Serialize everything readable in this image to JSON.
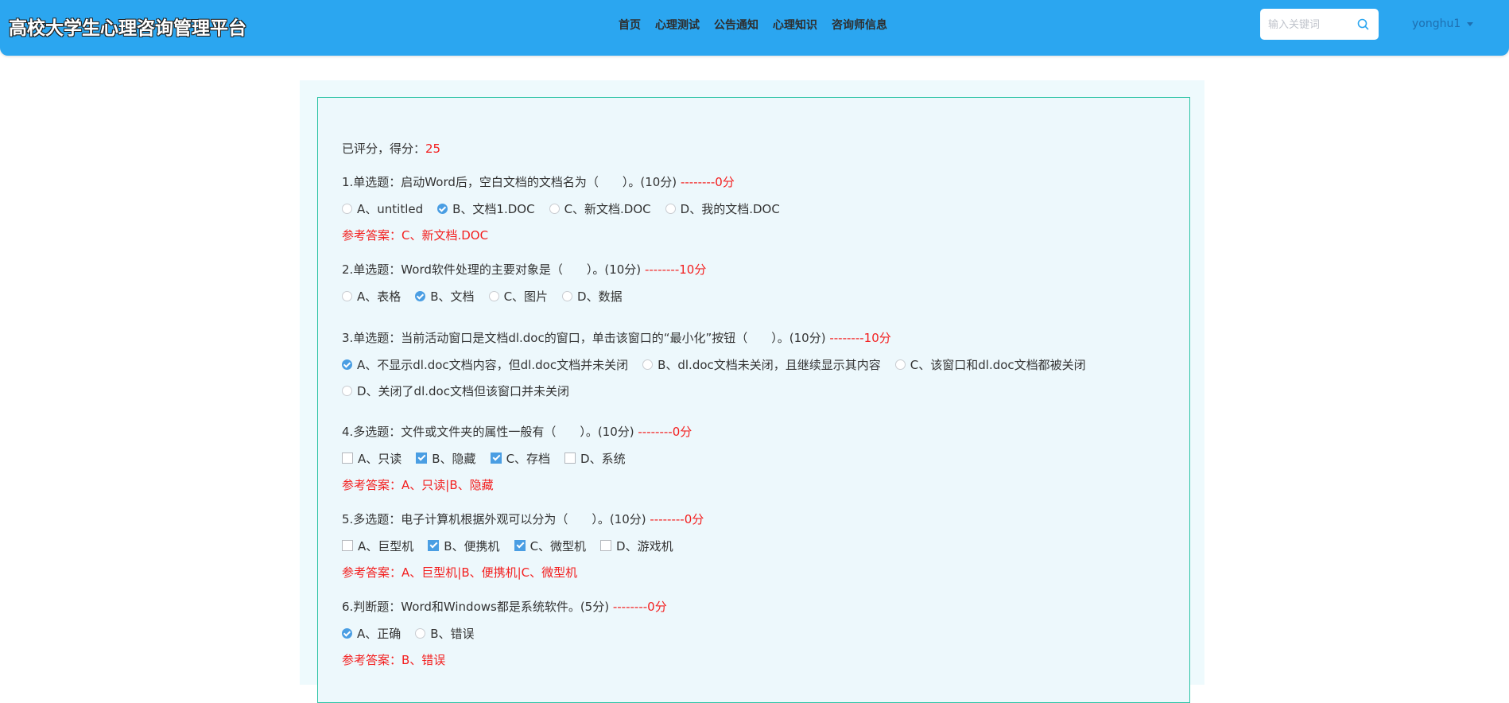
{
  "header": {
    "title": "高校大学生心理咨询管理平台",
    "nav": [
      "首页",
      "心理测试",
      "公告通知",
      "心理知识",
      "咨询师信息"
    ],
    "search_placeholder": "输入关键词",
    "user": "yonghu1"
  },
  "result": {
    "label": "已评分，得分：",
    "score": "25"
  },
  "questions": [
    {
      "title": "1.单选题：启动Word后，空白文档的文档名为（　　）。(10分)",
      "points": "--------0分",
      "options": [
        "A、untitled",
        "B、文档1.DOC",
        "C、新文档.DOC",
        "D、我的文档.DOC"
      ],
      "answer": "参考答案：C、新文档.DOC"
    },
    {
      "title": "2.单选题：Word软件处理的主要对象是（　　）。(10分)",
      "points": "--------10分",
      "options": [
        "A、表格",
        "B、文档",
        "C、图片",
        "D、数据"
      ]
    },
    {
      "title": "3.单选题：当前活动窗口是文档dl.doc的窗口，单击该窗口的“最小化”按钮（　　）。(10分)",
      "points": "--------10分",
      "options": [
        "A、不显示dl.doc文档内容，但dl.doc文档并未关闭",
        "B、dl.doc文档未关闭，且继续显示其内容",
        "C、该窗口和dl.doc文档都被关闭",
        "D、关闭了dl.doc文档但该窗口并未关闭"
      ]
    },
    {
      "title": "4.多选题：文件或文件夹的属性一般有（　　）。(10分)",
      "points": "--------0分",
      "options": [
        "A、只读",
        "B、隐藏",
        "C、存档",
        "D、系统"
      ],
      "answer": "参考答案：A、只读|B、隐藏"
    },
    {
      "title": "5.多选题：电子计算机根据外观可以分为（　　）。(10分)",
      "points": "--------0分",
      "options": [
        "A、巨型机",
        "B、便携机",
        "C、微型机",
        "D、游戏机"
      ],
      "answer": "参考答案：A、巨型机|B、便携机|C、微型机"
    },
    {
      "title": "6.判断题：Word和Windows都是系统软件。(5分)",
      "points": "--------0分",
      "options": [
        "A、正确",
        "B、错误"
      ],
      "answer": "参考答案：B、错误"
    }
  ]
}
